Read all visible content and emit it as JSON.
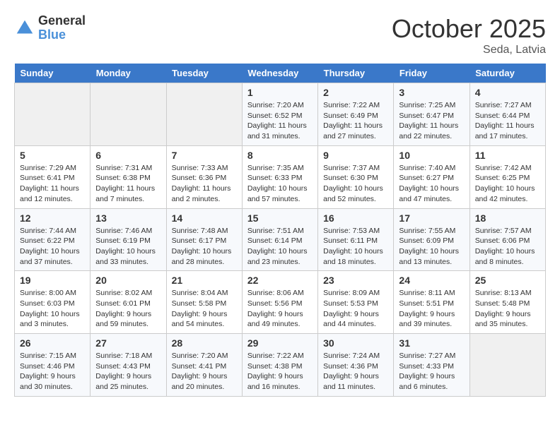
{
  "logo": {
    "line1": "General",
    "line2": "Blue"
  },
  "title": "October 2025",
  "subtitle": "Seda, Latvia",
  "days_header": [
    "Sunday",
    "Monday",
    "Tuesday",
    "Wednesday",
    "Thursday",
    "Friday",
    "Saturday"
  ],
  "weeks": [
    [
      {
        "day": "",
        "text": ""
      },
      {
        "day": "",
        "text": ""
      },
      {
        "day": "",
        "text": ""
      },
      {
        "day": "1",
        "text": "Sunrise: 7:20 AM\nSunset: 6:52 PM\nDaylight: 11 hours\nand 31 minutes."
      },
      {
        "day": "2",
        "text": "Sunrise: 7:22 AM\nSunset: 6:49 PM\nDaylight: 11 hours\nand 27 minutes."
      },
      {
        "day": "3",
        "text": "Sunrise: 7:25 AM\nSunset: 6:47 PM\nDaylight: 11 hours\nand 22 minutes."
      },
      {
        "day": "4",
        "text": "Sunrise: 7:27 AM\nSunset: 6:44 PM\nDaylight: 11 hours\nand 17 minutes."
      }
    ],
    [
      {
        "day": "5",
        "text": "Sunrise: 7:29 AM\nSunset: 6:41 PM\nDaylight: 11 hours\nand 12 minutes."
      },
      {
        "day": "6",
        "text": "Sunrise: 7:31 AM\nSunset: 6:38 PM\nDaylight: 11 hours\nand 7 minutes."
      },
      {
        "day": "7",
        "text": "Sunrise: 7:33 AM\nSunset: 6:36 PM\nDaylight: 11 hours\nand 2 minutes."
      },
      {
        "day": "8",
        "text": "Sunrise: 7:35 AM\nSunset: 6:33 PM\nDaylight: 10 hours\nand 57 minutes."
      },
      {
        "day": "9",
        "text": "Sunrise: 7:37 AM\nSunset: 6:30 PM\nDaylight: 10 hours\nand 52 minutes."
      },
      {
        "day": "10",
        "text": "Sunrise: 7:40 AM\nSunset: 6:27 PM\nDaylight: 10 hours\nand 47 minutes."
      },
      {
        "day": "11",
        "text": "Sunrise: 7:42 AM\nSunset: 6:25 PM\nDaylight: 10 hours\nand 42 minutes."
      }
    ],
    [
      {
        "day": "12",
        "text": "Sunrise: 7:44 AM\nSunset: 6:22 PM\nDaylight: 10 hours\nand 37 minutes."
      },
      {
        "day": "13",
        "text": "Sunrise: 7:46 AM\nSunset: 6:19 PM\nDaylight: 10 hours\nand 33 minutes."
      },
      {
        "day": "14",
        "text": "Sunrise: 7:48 AM\nSunset: 6:17 PM\nDaylight: 10 hours\nand 28 minutes."
      },
      {
        "day": "15",
        "text": "Sunrise: 7:51 AM\nSunset: 6:14 PM\nDaylight: 10 hours\nand 23 minutes."
      },
      {
        "day": "16",
        "text": "Sunrise: 7:53 AM\nSunset: 6:11 PM\nDaylight: 10 hours\nand 18 minutes."
      },
      {
        "day": "17",
        "text": "Sunrise: 7:55 AM\nSunset: 6:09 PM\nDaylight: 10 hours\nand 13 minutes."
      },
      {
        "day": "18",
        "text": "Sunrise: 7:57 AM\nSunset: 6:06 PM\nDaylight: 10 hours\nand 8 minutes."
      }
    ],
    [
      {
        "day": "19",
        "text": "Sunrise: 8:00 AM\nSunset: 6:03 PM\nDaylight: 10 hours\nand 3 minutes."
      },
      {
        "day": "20",
        "text": "Sunrise: 8:02 AM\nSunset: 6:01 PM\nDaylight: 9 hours\nand 59 minutes."
      },
      {
        "day": "21",
        "text": "Sunrise: 8:04 AM\nSunset: 5:58 PM\nDaylight: 9 hours\nand 54 minutes."
      },
      {
        "day": "22",
        "text": "Sunrise: 8:06 AM\nSunset: 5:56 PM\nDaylight: 9 hours\nand 49 minutes."
      },
      {
        "day": "23",
        "text": "Sunrise: 8:09 AM\nSunset: 5:53 PM\nDaylight: 9 hours\nand 44 minutes."
      },
      {
        "day": "24",
        "text": "Sunrise: 8:11 AM\nSunset: 5:51 PM\nDaylight: 9 hours\nand 39 minutes."
      },
      {
        "day": "25",
        "text": "Sunrise: 8:13 AM\nSunset: 5:48 PM\nDaylight: 9 hours\nand 35 minutes."
      }
    ],
    [
      {
        "day": "26",
        "text": "Sunrise: 7:15 AM\nSunset: 4:46 PM\nDaylight: 9 hours\nand 30 minutes."
      },
      {
        "day": "27",
        "text": "Sunrise: 7:18 AM\nSunset: 4:43 PM\nDaylight: 9 hours\nand 25 minutes."
      },
      {
        "day": "28",
        "text": "Sunrise: 7:20 AM\nSunset: 4:41 PM\nDaylight: 9 hours\nand 20 minutes."
      },
      {
        "day": "29",
        "text": "Sunrise: 7:22 AM\nSunset: 4:38 PM\nDaylight: 9 hours\nand 16 minutes."
      },
      {
        "day": "30",
        "text": "Sunrise: 7:24 AM\nSunset: 4:36 PM\nDaylight: 9 hours\nand 11 minutes."
      },
      {
        "day": "31",
        "text": "Sunrise: 7:27 AM\nSunset: 4:33 PM\nDaylight: 9 hours\nand 6 minutes."
      },
      {
        "day": "",
        "text": ""
      }
    ]
  ]
}
